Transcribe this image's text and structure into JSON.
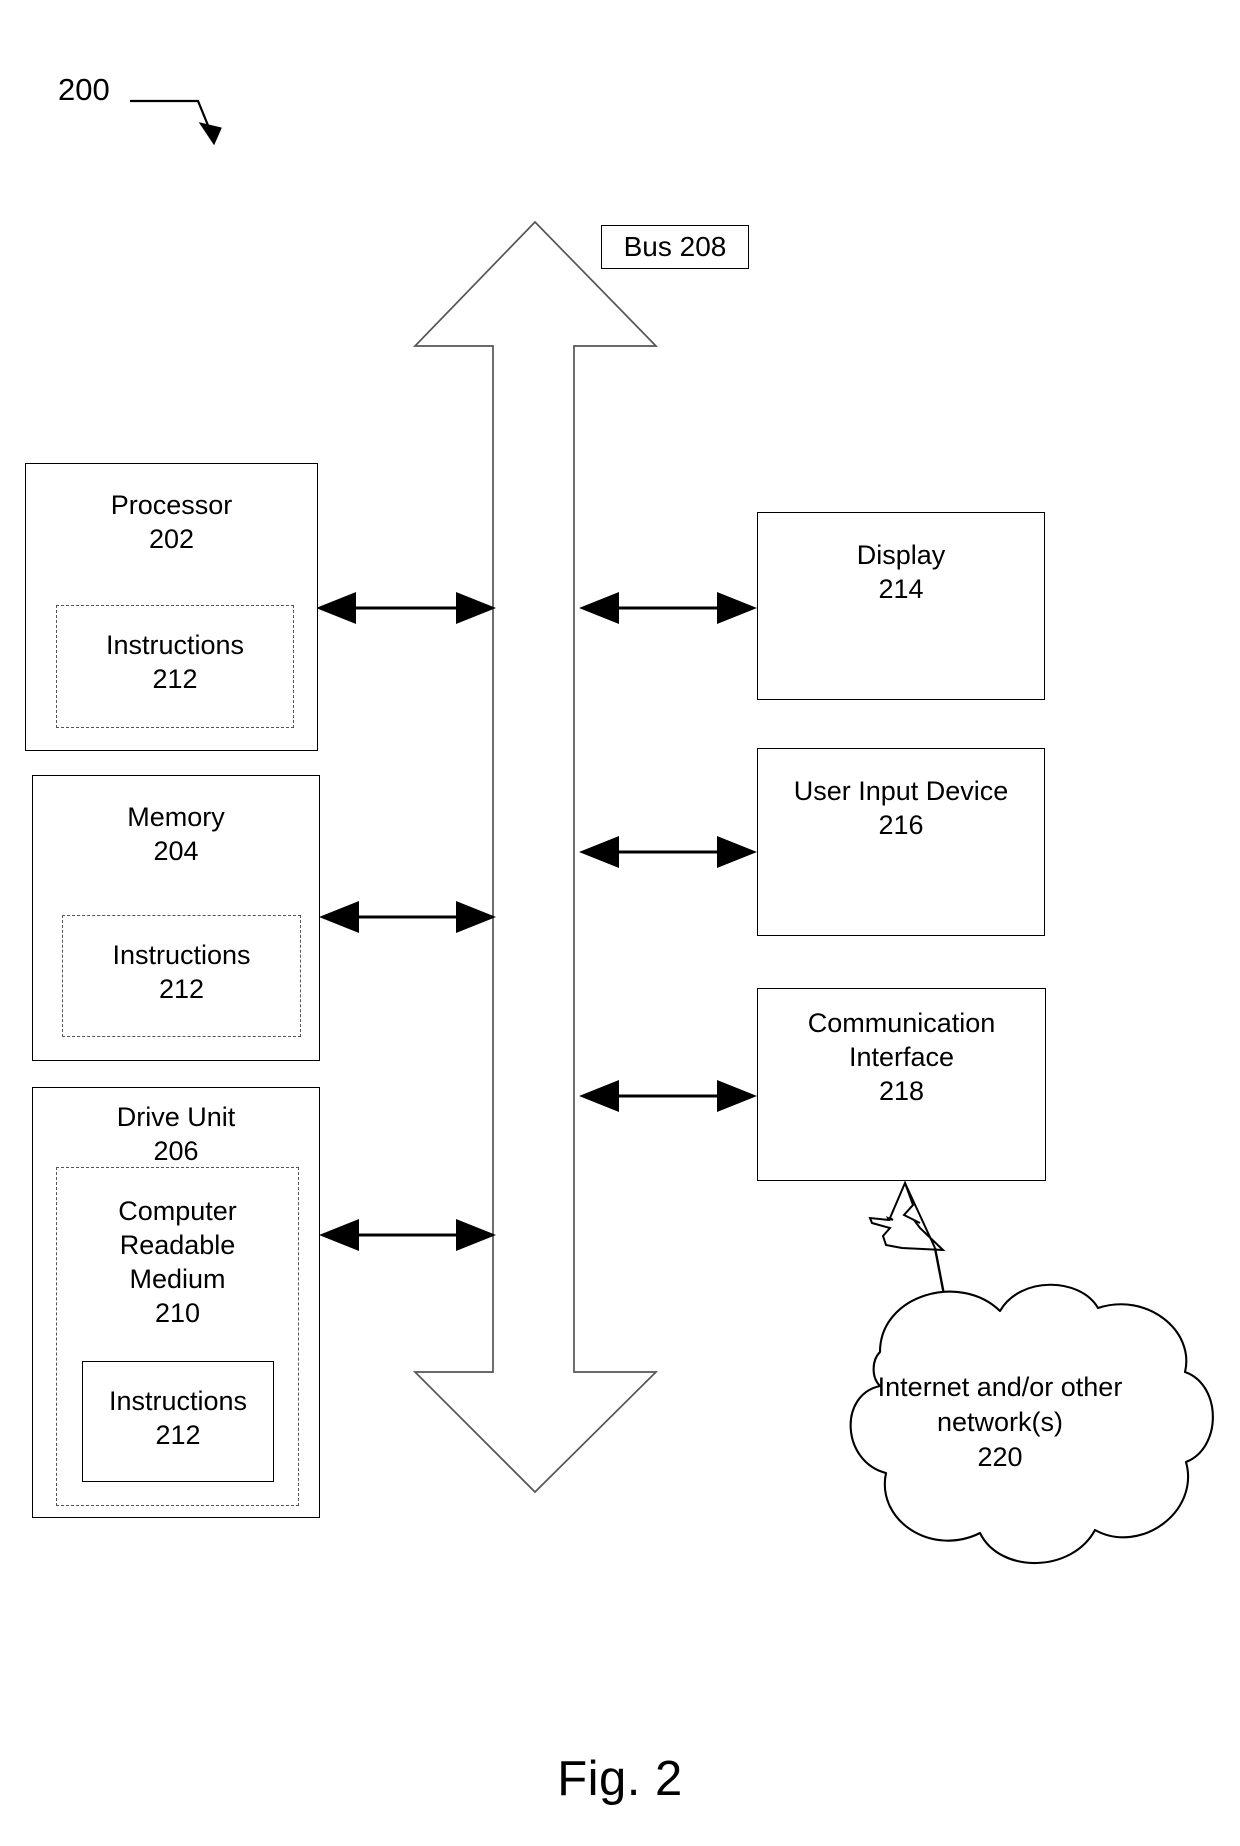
{
  "figure": {
    "reference_number": "200",
    "caption": "Fig. 2"
  },
  "bus": {
    "label": "Bus 208"
  },
  "nodes": {
    "processor": {
      "title": "Processor\n202",
      "inner": {
        "title": "Instructions\n212"
      }
    },
    "memory": {
      "title": "Memory\n204",
      "inner": {
        "title": "Instructions\n212"
      }
    },
    "drive_unit": {
      "title": "Drive Unit\n206",
      "medium": {
        "title": "Computer\nReadable\nMedium\n210",
        "inner": {
          "title": "Instructions\n212"
        }
      }
    },
    "display": {
      "title": "Display\n214"
    },
    "user_input_device": {
      "title": "User Input Device\n216"
    },
    "communication_interface": {
      "title": "Communication\nInterface\n218"
    },
    "network_cloud": {
      "title": "Internet and/or other\nnetwork(s)\n220"
    }
  },
  "colors": {
    "stroke": "#000000",
    "dashed_stroke": "#555555",
    "background": "#ffffff"
  }
}
